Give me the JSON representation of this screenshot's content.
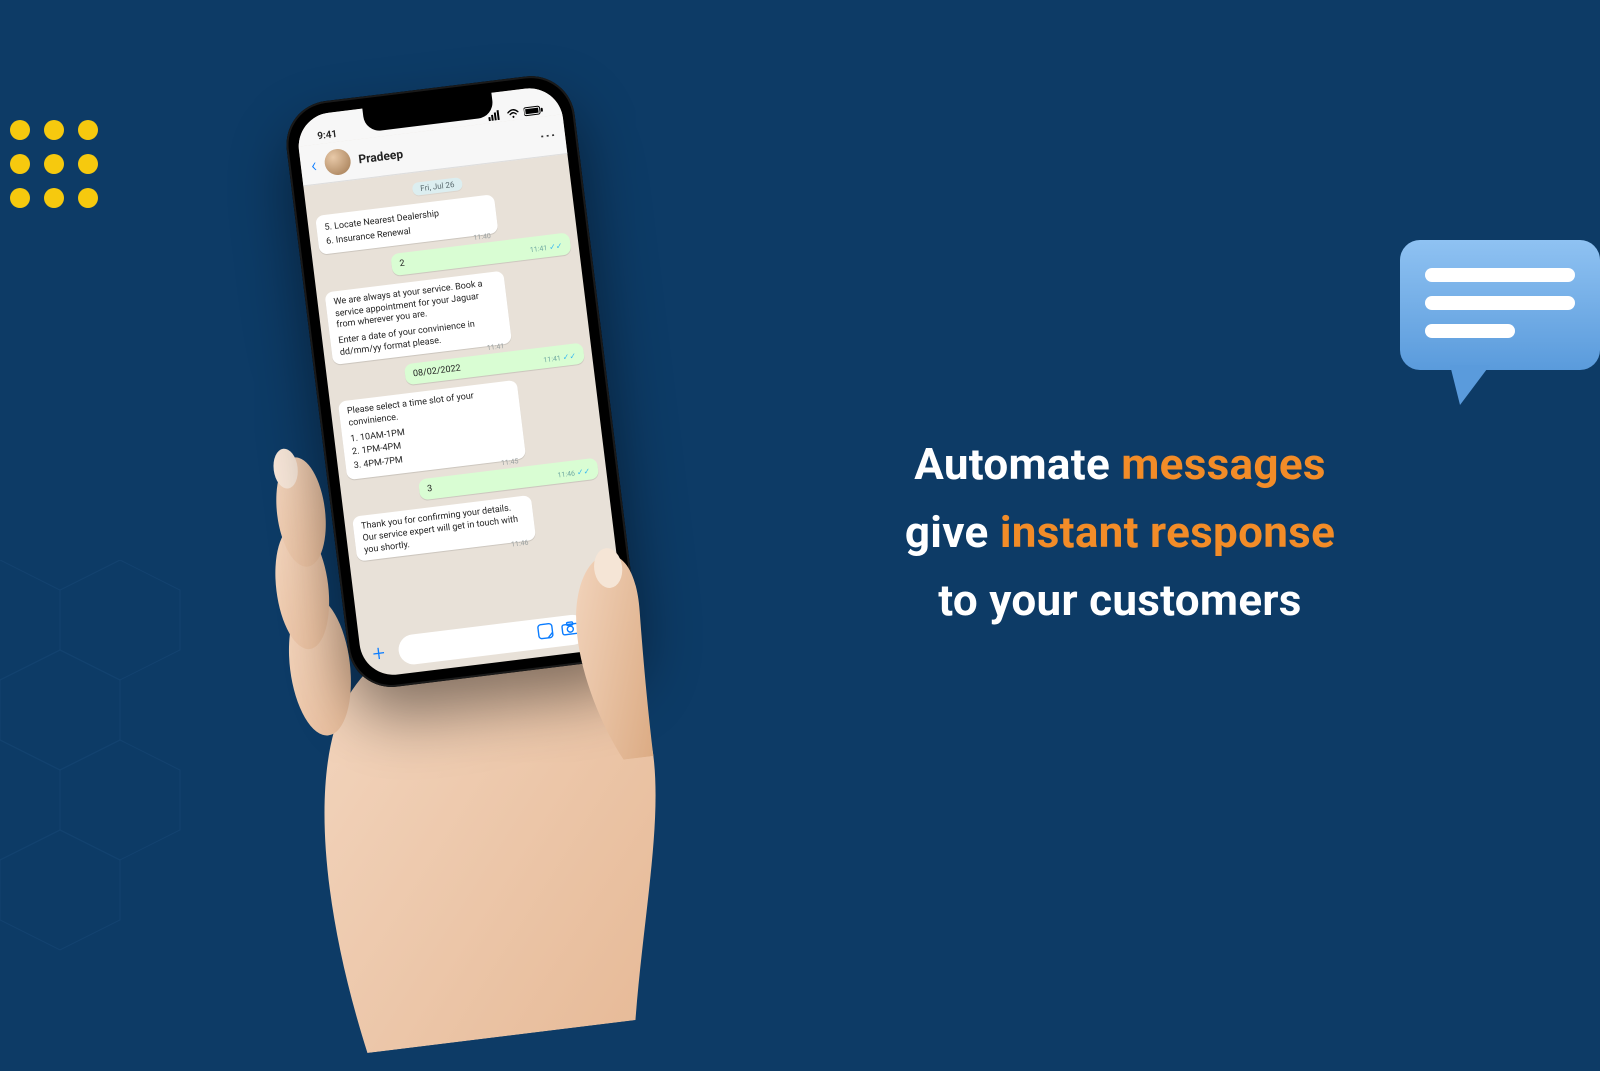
{
  "headline": {
    "part1": "Automate ",
    "accent1": "messages",
    "part2": "give ",
    "accent2": "instant response",
    "part3": "to your customers"
  },
  "phone": {
    "status_time": "9:41",
    "contact_name": "Pradeep",
    "date_chip": "Fri, Jul 26",
    "msgs": [
      {
        "dir": "in",
        "lines": [
          "5. Locate Nearest Dealership",
          "6. Insurance Renewal"
        ],
        "ts": "11:40"
      },
      {
        "dir": "out",
        "lines": [
          "2"
        ],
        "ts": "11:41"
      },
      {
        "dir": "in",
        "lines": [
          "We are always at your service. Book a service appointment for your Jaguar from wherever you are.",
          "Enter a date of your convinience in dd/mm/yy format please."
        ],
        "ts": "11:41"
      },
      {
        "dir": "out",
        "lines": [
          "08/02/2022"
        ],
        "ts": "11:41"
      },
      {
        "dir": "in",
        "lines": [
          "Please select a time slot of your convinience.",
          "1. 10AM-1PM",
          "2. 1PM-4PM",
          "3. 4PM-7PM"
        ],
        "ts": "11:45"
      },
      {
        "dir": "out",
        "lines": [
          "3"
        ],
        "ts": "11:46"
      },
      {
        "dir": "in",
        "lines": [
          "Thank you for confirming your details. Our service expert will get in touch with you shortly."
        ],
        "ts": "11:46"
      }
    ]
  }
}
